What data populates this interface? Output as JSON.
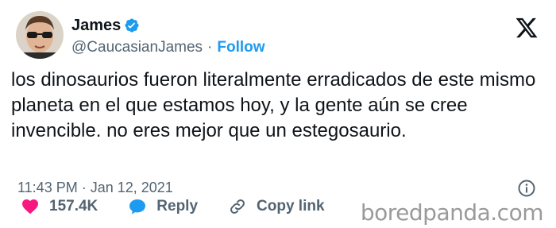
{
  "author": {
    "name": "James",
    "handle": "@CaucasianJames",
    "separator": "·",
    "follow_label": "Follow"
  },
  "tweet": {
    "text": "los dinosaurios fueron literalmente erradicados de este mismo planeta en el que estamos hoy, y la gente aún se cree invencible. no eres mejor que un estegosaurio.",
    "timestamp": "11:43 PM · Jan 12, 2021"
  },
  "actions": {
    "like_count": "157.4K",
    "reply_label": "Reply",
    "copy_label": "Copy link"
  },
  "watermark": "boredpanda.com",
  "icons": {
    "verified": "verified-badge-icon",
    "x_logo": "x-logo-icon",
    "info": "info-icon",
    "like": "heart-icon",
    "reply": "speech-bubble-icon",
    "copy": "link-icon"
  },
  "colors": {
    "accent": "#1d9bf0",
    "like": "#f91880",
    "text": "#0f1419",
    "muted": "#536471"
  }
}
